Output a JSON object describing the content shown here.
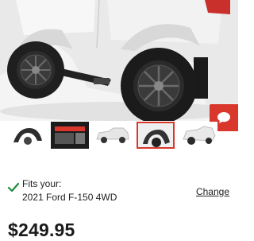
{
  "fitment": {
    "label": "Fits your:",
    "vehicle": "2021 Ford F-150 4WD",
    "change_label": "Change",
    "check_color": "#1f8a3a"
  },
  "price": "$249.95",
  "gallery": {
    "main_image": "truck-fender-flares-photo",
    "thumbnails": [
      {
        "name": "fender-flare-part",
        "active": false
      },
      {
        "name": "kit-box-photo",
        "active": false
      },
      {
        "name": "truck-side-view",
        "active": false
      },
      {
        "name": "fender-closeup",
        "active": true
      },
      {
        "name": "truck-angle-view",
        "active": false
      }
    ]
  },
  "chat_button": {
    "icon": "chat-bubble-icon",
    "color": "#d9372b"
  }
}
